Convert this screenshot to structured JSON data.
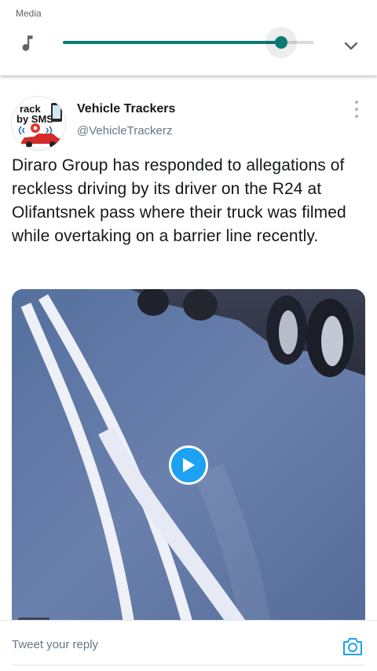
{
  "media_panel": {
    "title": "Media",
    "volume_level": 0.87,
    "accent_color": "#0b7a72",
    "icons": {
      "left": "music-note-icon",
      "right": "chevron-down-icon"
    }
  },
  "tweet": {
    "user": {
      "name": "Vehicle Trackers",
      "handle": "@VehicleTrackerz",
      "avatar_text_line1": "rack",
      "avatar_text_line2": "by SMS"
    },
    "text": "Diraro Group has responded to allegations of reckless driving by its driver on the R24 at Olifantsnek pass where their truck was filmed while overtaking on a barrier line recently.",
    "more_icon": "more-vertical-icon",
    "video": {
      "play_icon": "play-icon",
      "accent_color": "#1da1f2"
    }
  },
  "reply": {
    "placeholder": "Tweet your reply",
    "camera_icon": "camera-icon",
    "accent_color": "#1da1f2"
  }
}
